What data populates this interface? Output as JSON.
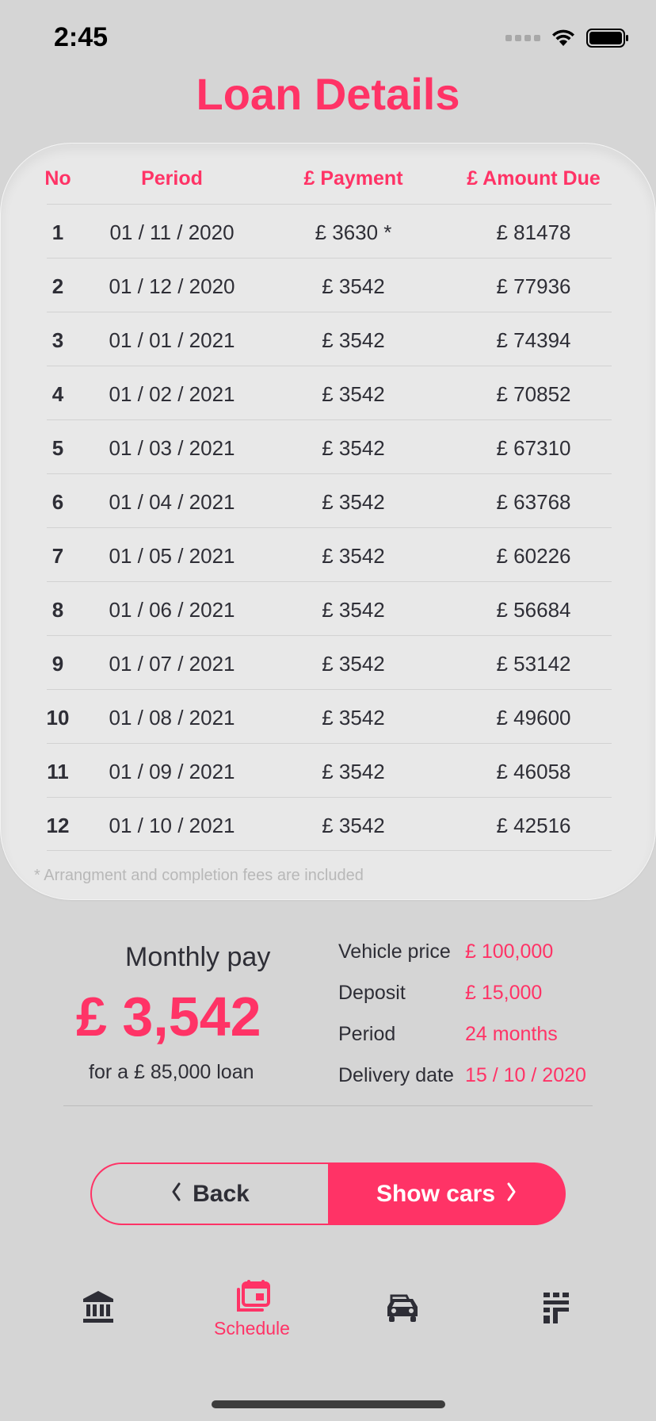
{
  "status_bar": {
    "time": "2:45"
  },
  "page": {
    "title": "Loan Details"
  },
  "table": {
    "headers": {
      "no": "No",
      "period": "Period",
      "payment": "£ Payment",
      "amount_due": "£ Amount Due"
    },
    "rows": [
      {
        "no": "1",
        "period": "01 / 11 / 2020",
        "payment": "£ 3630 *",
        "amount_due": "£ 81478"
      },
      {
        "no": "2",
        "period": "01 / 12 / 2020",
        "payment": "£ 3542",
        "amount_due": "£ 77936"
      },
      {
        "no": "3",
        "period": "01 / 01 / 2021",
        "payment": "£ 3542",
        "amount_due": "£ 74394"
      },
      {
        "no": "4",
        "period": "01 / 02 / 2021",
        "payment": "£ 3542",
        "amount_due": "£ 70852"
      },
      {
        "no": "5",
        "period": "01 / 03 / 2021",
        "payment": "£ 3542",
        "amount_due": "£ 67310"
      },
      {
        "no": "6",
        "period": "01 / 04 / 2021",
        "payment": "£ 3542",
        "amount_due": "£ 63768"
      },
      {
        "no": "7",
        "period": "01 / 05 / 2021",
        "payment": "£ 3542",
        "amount_due": "£ 60226"
      },
      {
        "no": "8",
        "period": "01 / 06 / 2021",
        "payment": "£ 3542",
        "amount_due": "£ 56684"
      },
      {
        "no": "9",
        "period": "01 / 07 / 2021",
        "payment": "£ 3542",
        "amount_due": "£ 53142"
      },
      {
        "no": "10",
        "period": "01 / 08 / 2021",
        "payment": "£ 3542",
        "amount_due": "£ 49600"
      },
      {
        "no": "11",
        "period": "01 / 09 / 2021",
        "payment": "£ 3542",
        "amount_due": "£ 46058"
      },
      {
        "no": "12",
        "period": "01 / 10 / 2021",
        "payment": "£ 3542",
        "amount_due": "£ 42516"
      }
    ],
    "footnote": "* Arrangment and completion fees are included"
  },
  "summary": {
    "monthly_label": "Monthly pay",
    "monthly_value": "£ 3,542",
    "loan_note": "for a £ 85,000 loan",
    "details": [
      {
        "label": "Vehicle price",
        "value": "£ 100,000"
      },
      {
        "label": "Deposit",
        "value": "£ 15,000"
      },
      {
        "label": "Period",
        "value": "24 months"
      },
      {
        "label": "Delivery date",
        "value": "15 / 10 / 2020"
      }
    ]
  },
  "buttons": {
    "back": "Back",
    "show_cars": "Show cars",
    "back_icon": "chevron-left-icon",
    "show_icon": "chevron-right-icon"
  },
  "tab_bar": {
    "items": [
      {
        "icon": "bank-icon",
        "label": ""
      },
      {
        "icon": "schedule-icon",
        "label": "Schedule",
        "active": true
      },
      {
        "icon": "car-icon",
        "label": ""
      },
      {
        "icon": "grid-icon",
        "label": ""
      }
    ]
  },
  "colors": {
    "accent": "#ff3366",
    "text": "#2e2e36",
    "background": "#d5d5d5",
    "card": "#e8e8e8"
  }
}
